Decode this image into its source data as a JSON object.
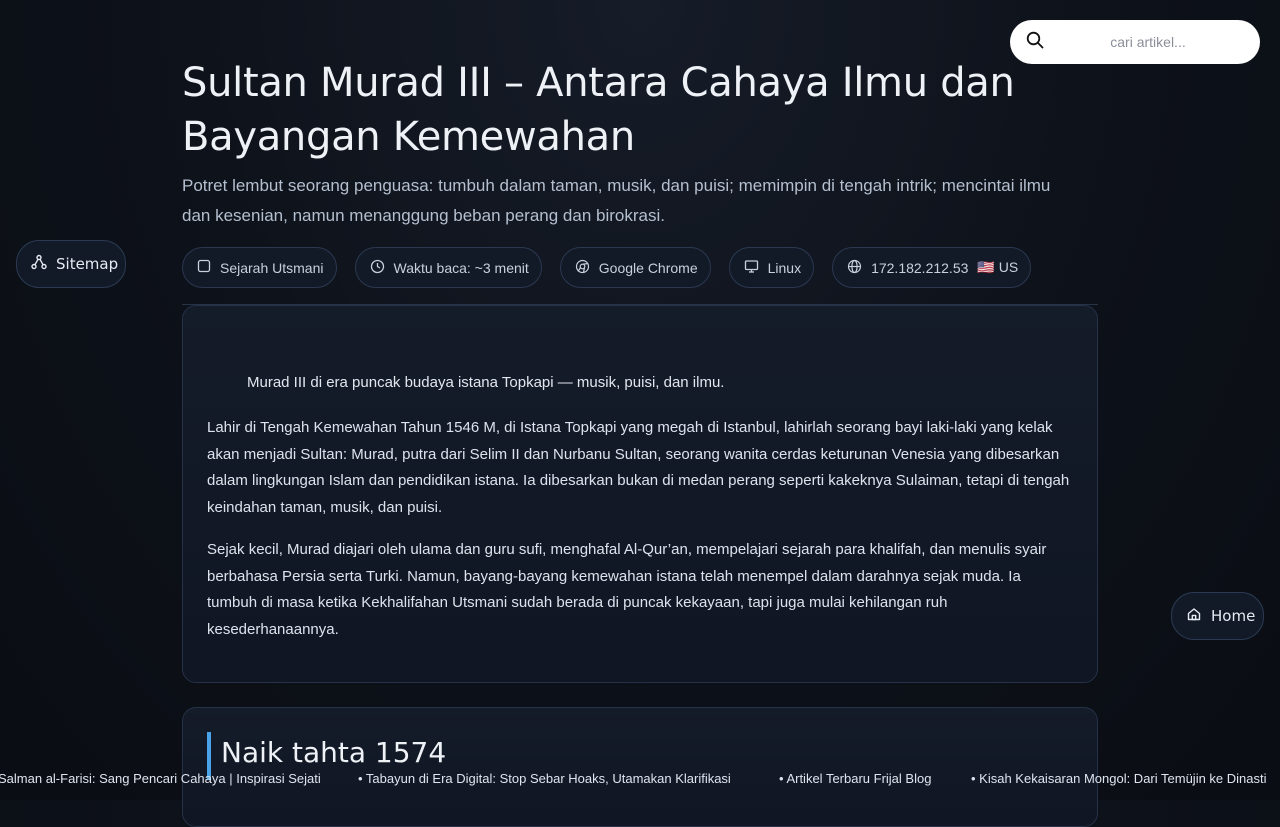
{
  "search": {
    "placeholder": "cari artikel..."
  },
  "nav": {
    "sitemap_label": "Sitemap",
    "home_label": "Home"
  },
  "article": {
    "title": "Sultan Murad III – Antara Cahaya Ilmu dan Bayangan Kemewahan",
    "subtitle": "Potret lembut seorang penguasa: tumbuh dalam taman, musik, dan puisi; memimpin di tengah intrik; mencintai ilmu dan kesenian, namun menanggung beban perang dan birokrasi.",
    "meta": {
      "category": "Sejarah Utsmani",
      "read_time": "Waktu baca: ~3 menit",
      "browser": "Google Chrome",
      "os": "Linux",
      "ip": "172.182.212.53",
      "country": "🇺🇸 US"
    },
    "image_caption": "Murad III di era puncak budaya istana Topkapi — musik, puisi, dan ilmu.",
    "paragraphs": [
      "Lahir di Tengah Kemewahan Tahun 1546 M, di Istana Topkapi yang megah di Istanbul, lahirlah seorang bayi laki-laki yang kelak akan menjadi Sultan: Murad, putra dari Selim II dan Nurbanu Sultan, seorang wanita cerdas keturunan Venesia yang dibesarkan dalam lingkungan Islam dan pendidikan istana. Ia dibesarkan bukan di medan perang seperti kakeknya Sulaiman, tetapi di tengah keindahan taman, musik, dan puisi.",
      "Sejak kecil, Murad diajari oleh ulama dan guru sufi, menghafal Al-Qur’an, mempelajari sejarah para khalifah, dan menulis syair berbahasa Persia serta Turki. Namun, bayang-bayang kemewahan istana telah menempel dalam darahnya sejak muda. Ia tumbuh di masa ketika Kekhalifahan Utsmani sudah berada di puncak kekayaan, tapi juga mulai kehilangan ruh kesederhanaannya."
    ],
    "section_heading": "Naik tahta 1574"
  },
  "ticker": [
    "Salman al-Farisi: Sang Pencari Cahaya | Inspirasi Sejati",
    "• Tabayun di Era Digital: Stop Sebar Hoaks, Utamakan Klarifikasi",
    "• Artikel Terbaru Frijal Blog",
    "• Kisah Kekaisaran Mongol: Dari Temüjin ke Dinasti"
  ],
  "colors": {
    "accent": "#4aa3e8",
    "card_bg": "#141b29",
    "page_bg": "#0d1119"
  }
}
